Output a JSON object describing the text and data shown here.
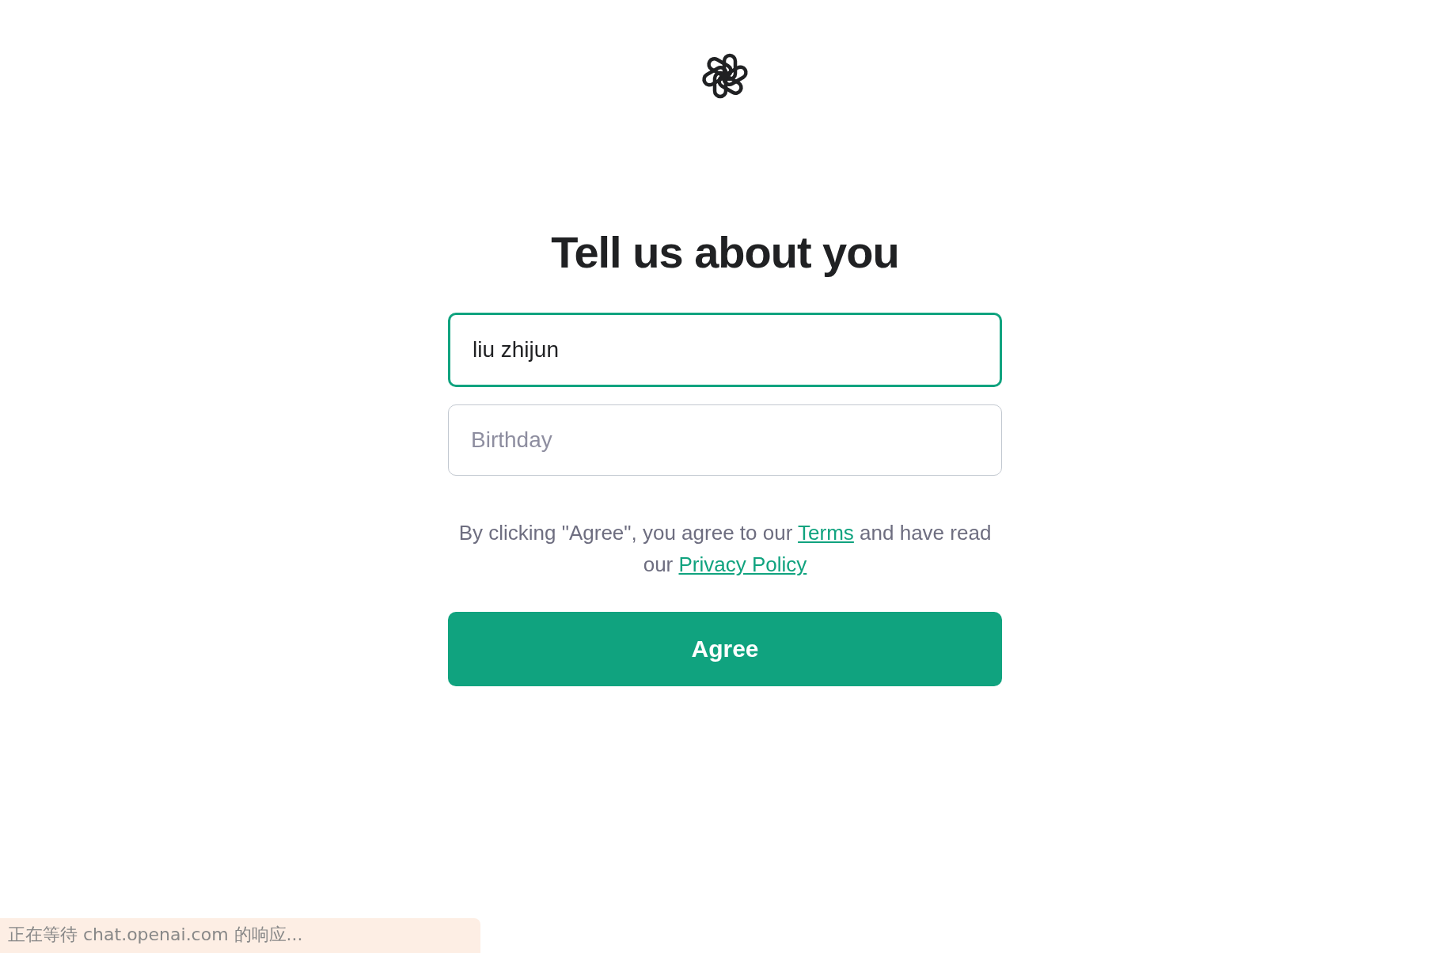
{
  "title": "Tell us about you",
  "name_field": {
    "value": "liu zhijun",
    "focused": true
  },
  "birthday_field": {
    "placeholder": "Birthday",
    "focused": false
  },
  "legal": {
    "before": "By clicking \"Agree\", you agree to our ",
    "terms_link": "Terms",
    "middle": " and have read our ",
    "privacy_link": "Privacy Policy"
  },
  "agree_button": "Agree",
  "status_bar": "正在等待 chat.openai.com 的响应..."
}
